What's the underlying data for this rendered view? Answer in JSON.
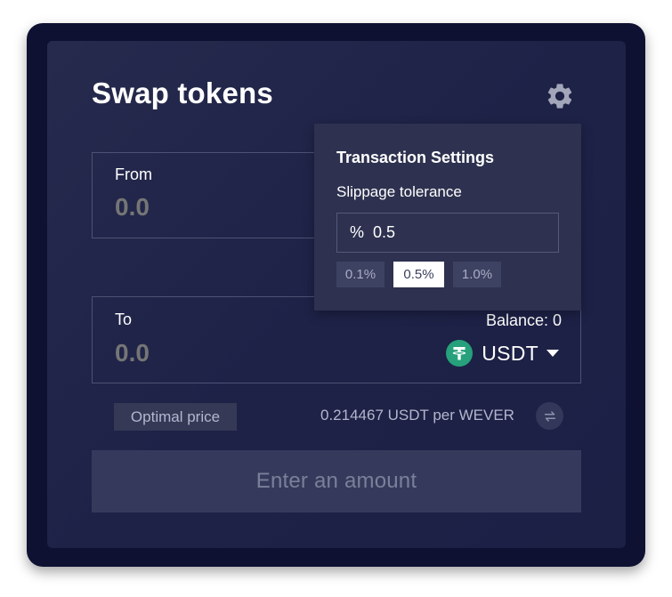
{
  "page": {
    "title": "Swap tokens"
  },
  "from": {
    "label": "From",
    "value": "0.0"
  },
  "to": {
    "label": "To",
    "value": "0.0",
    "balance": "Balance: 0",
    "token": "USDT"
  },
  "settings": {
    "title": "Transaction Settings",
    "slippage_label": "Slippage tolerance",
    "percent_symbol": "%",
    "slippage_value": "0.5",
    "presets": [
      "0.1%",
      "0.5%",
      "1.0%"
    ],
    "selected_preset": "0.5%"
  },
  "price": {
    "optimal_label": "Optimal price",
    "rate": "0.214467 USDT per WEVER"
  },
  "submit": {
    "label": "Enter an amount"
  },
  "colors": {
    "background": "#0e1131",
    "card": "#1e2247",
    "popover": "#2e3250",
    "usdt": "#26a17b",
    "muted_text": "#6f738e"
  },
  "icons": {
    "settings": "gear-icon",
    "token": "tether-icon",
    "dropdown": "caret-down-icon",
    "swap_direction": "swap-arrows-icon"
  }
}
